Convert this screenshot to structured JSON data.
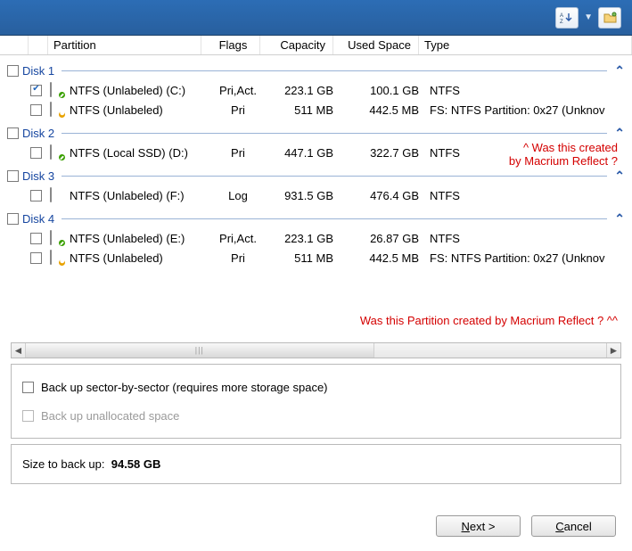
{
  "columns": {
    "partition": "Partition",
    "flags": "Flags",
    "capacity": "Capacity",
    "used": "Used Space",
    "type": "Type"
  },
  "disks": [
    {
      "label": "Disk 1",
      "rows": [
        {
          "checked": true,
          "badge": "g",
          "name": "NTFS (Unlabeled) (C:)",
          "flags": "Pri,Act.",
          "capacity": "223.1 GB",
          "used": "100.1 GB",
          "type": "NTFS"
        },
        {
          "checked": false,
          "badge": "y",
          "name": "NTFS (Unlabeled)",
          "flags": "Pri",
          "capacity": "511 MB",
          "used": "442.5 MB",
          "type": "FS: NTFS Partition: 0x27 (Unknov"
        }
      ]
    },
    {
      "label": "Disk 2",
      "rows": [
        {
          "checked": false,
          "badge": "g",
          "name": "NTFS (Local SSD) (D:)",
          "flags": "Pri",
          "capacity": "447.1 GB",
          "used": "322.7 GB",
          "type": "NTFS"
        }
      ]
    },
    {
      "label": "Disk 3",
      "rows": [
        {
          "checked": false,
          "badge": "",
          "name": "NTFS (Unlabeled) (F:)",
          "flags": "Log",
          "capacity": "931.5 GB",
          "used": "476.4 GB",
          "type": "NTFS"
        }
      ]
    },
    {
      "label": "Disk 4",
      "rows": [
        {
          "checked": false,
          "badge": "g",
          "name": "NTFS (Unlabeled) (E:)",
          "flags": "Pri,Act.",
          "capacity": "223.1 GB",
          "used": "26.87 GB",
          "type": "NTFS"
        },
        {
          "checked": false,
          "badge": "y",
          "name": "NTFS (Unlabeled)",
          "flags": "Pri",
          "capacity": "511 MB",
          "used": "442.5 MB",
          "type": "FS: NTFS Partition: 0x27 (Unknov"
        }
      ]
    }
  ],
  "annotations": {
    "a1_line1": "^ Was this created",
    "a1_line2": "by Macrium Reflect ?",
    "a2": "Was this Partition created by Macrium Reflect ? ^^"
  },
  "options": {
    "sector": "Back up sector-by-sector (requires more storage space)",
    "unalloc": "Back up unallocated space"
  },
  "size": {
    "label": "Size to back up:",
    "value": "94.58 GB"
  },
  "footer": {
    "next_pre": "N",
    "next_post": "ext >",
    "cancel_pre": "C",
    "cancel_post": "ancel"
  }
}
